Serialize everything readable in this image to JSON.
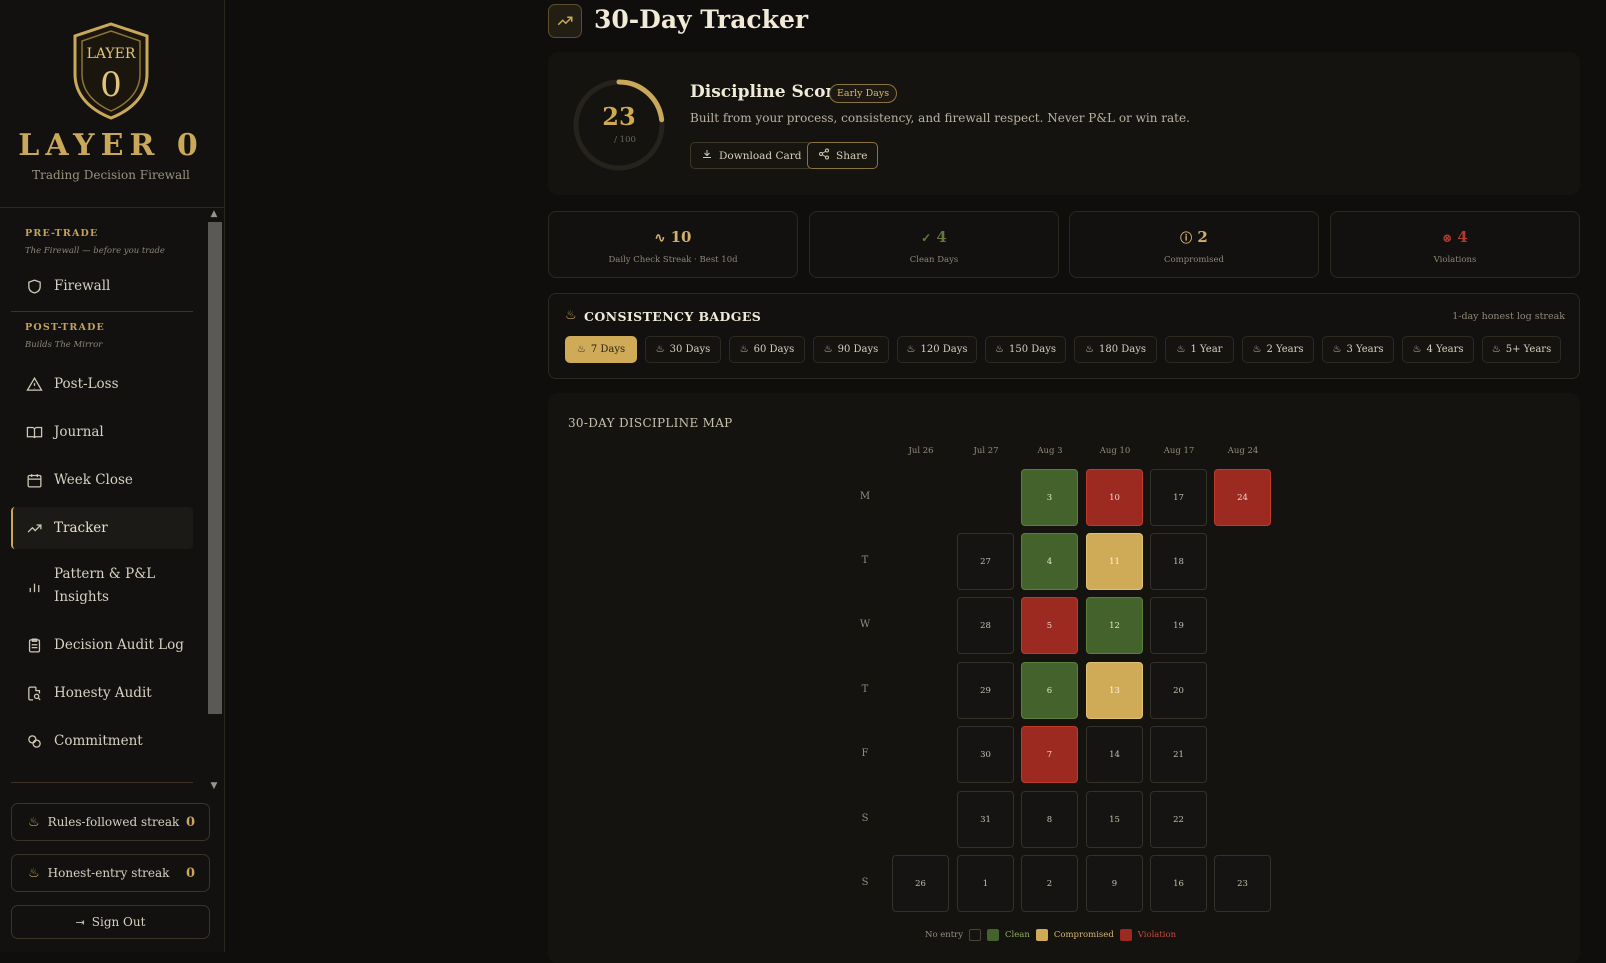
{
  "brand": {
    "shield_text": "LAYER",
    "shield_digit": "0",
    "name": "LAYER 0",
    "tagline": "Trading Decision Firewall"
  },
  "sidebar": {
    "pretrade": {
      "title": "PRE-TRADE",
      "subtitle": "The Firewall — before you trade"
    },
    "posttrade": {
      "title": "POST-TRADE",
      "subtitle": "Builds The Mirror"
    },
    "items": [
      {
        "label": "Firewall",
        "icon": "shield-icon"
      },
      {
        "label": "Post-Loss",
        "icon": "warning-icon"
      },
      {
        "label": "Journal",
        "icon": "book-icon"
      },
      {
        "label": "Week Close",
        "icon": "calendar-icon"
      },
      {
        "label": "Tracker",
        "icon": "trend-up-icon",
        "active": true
      },
      {
        "label_line1": "Pattern & P&L",
        "label_line2": "Insights",
        "icon": "bar-chart-icon"
      },
      {
        "label": "Decision Audit Log",
        "icon": "clipboard-icon"
      },
      {
        "label": "Honesty Audit",
        "icon": "file-search-icon"
      },
      {
        "label": "Commitment",
        "icon": "handshake-icon"
      }
    ],
    "streaks": [
      {
        "label": "Rules-followed streak",
        "value": "0"
      },
      {
        "label": "Honest-entry streak",
        "value": "0"
      }
    ],
    "sign_out": "Sign Out"
  },
  "header": {
    "title": "30-Day Tracker",
    "icon": "trend-up-icon"
  },
  "score": {
    "value": "23",
    "max_label": "/ 100",
    "fraction": 0.23,
    "title": "Discipline Score",
    "badge": "Early Days",
    "description": "Built from your process, consistency, and firewall respect. Never P&L or win rate.",
    "download_label": "Download Card",
    "share_label": "Share"
  },
  "stats": [
    {
      "value": "10",
      "label": "Daily Check Streak · Best 10d",
      "icon": "pulse-icon",
      "color": "#d2b06a"
    },
    {
      "value": "4",
      "label": "Clean Days",
      "icon": "check-circle-icon",
      "color": "#5f7a3b"
    },
    {
      "value": "2",
      "label": "Compromised",
      "icon": "alert-circle-icon",
      "color": "#d2b06a"
    },
    {
      "value": "4",
      "label": "Violations",
      "icon": "x-circle-icon",
      "color": "#b43a2d"
    }
  ],
  "badges": {
    "title": "CONSISTENCY BADGES",
    "right_note": "1-day honest log streak",
    "items": [
      "7 Days",
      "30 Days",
      "60 Days",
      "90 Days",
      "120 Days",
      "150 Days",
      "180 Days",
      "1 Year",
      "2 Years",
      "3 Years",
      "4 Years",
      "5+ Years"
    ],
    "active_index": 0
  },
  "map": {
    "title": "30-DAY DISCIPLINE MAP",
    "weeks": [
      "Jul 26",
      "Jul 27",
      "Aug 3",
      "Aug 10",
      "Aug 17",
      "Aug 24"
    ],
    "days": [
      "M",
      "T",
      "W",
      "T",
      "F",
      "S",
      "S"
    ],
    "grid": [
      [
        null,
        {
          "d": "27",
          "s": "none"
        },
        {
          "d": "28",
          "s": "none"
        },
        {
          "d": "29",
          "s": "none"
        },
        {
          "d": "30",
          "s": "none"
        },
        {
          "d": "31",
          "s": "none"
        },
        {
          "d": "1",
          "s": "none"
        }
      ],
      [
        {
          "d": "3",
          "s": "clean"
        },
        {
          "d": "4",
          "s": "clean"
        },
        {
          "d": "5",
          "s": "violation"
        },
        {
          "d": "6",
          "s": "clean"
        },
        {
          "d": "7",
          "s": "violation"
        },
        {
          "d": "8",
          "s": "none"
        },
        {
          "d": "2",
          "s": "none"
        }
      ],
      [
        {
          "d": "10",
          "s": "violation"
        },
        {
          "d": "11",
          "s": "compromised"
        },
        {
          "d": "12",
          "s": "clean"
        },
        {
          "d": "13",
          "s": "compromised"
        },
        {
          "d": "14",
          "s": "none"
        },
        {
          "d": "15",
          "s": "none"
        },
        {
          "d": "9",
          "s": "none"
        }
      ],
      [
        {
          "d": "17",
          "s": "none"
        },
        {
          "d": "18",
          "s": "none"
        },
        {
          "d": "19",
          "s": "none"
        },
        {
          "d": "20",
          "s": "none"
        },
        {
          "d": "21",
          "s": "none"
        },
        {
          "d": "22",
          "s": "none"
        },
        {
          "d": "16",
          "s": "none"
        }
      ],
      [
        {
          "d": "24",
          "s": "violation"
        },
        null,
        null,
        null,
        null,
        null,
        {
          "d": "23",
          "s": "none"
        }
      ]
    ],
    "first_sunday": {
      "d": "26",
      "s": "none"
    },
    "legend": [
      {
        "label": "No entry",
        "color": "#151412",
        "text_color": "#958d7b"
      },
      {
        "label": "Clean",
        "color": "#44622b",
        "text_color": "#8fb062"
      },
      {
        "label": "Compromised",
        "color": "#cfab58",
        "text_color": "#d6b86d"
      },
      {
        "label": "Violation",
        "color": "#9c2a20",
        "text_color": "#c84a3c"
      }
    ]
  }
}
